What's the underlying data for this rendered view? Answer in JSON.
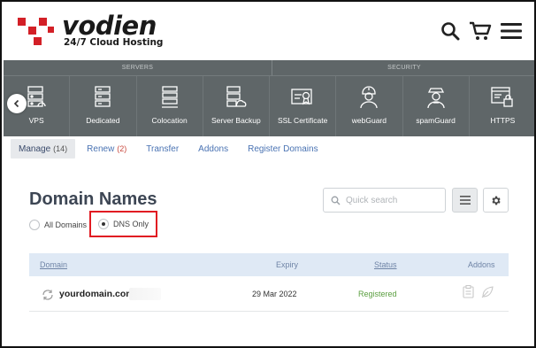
{
  "brand": {
    "name": "vodien",
    "tagline": "24/7 Cloud Hosting",
    "colors": {
      "logo_red": "#d32027",
      "logo_text": "#1a1a1a"
    }
  },
  "header": {
    "icons": [
      "search-icon",
      "cart-icon",
      "menu-icon"
    ]
  },
  "categories": {
    "servers_heading": "SERVERS",
    "security_heading": "SECURITY",
    "items": [
      {
        "label": "VPS",
        "icon": "vps-server-icon"
      },
      {
        "label": "Dedicated",
        "icon": "dedicated-server-icon"
      },
      {
        "label": "Colocation",
        "icon": "colocation-icon"
      },
      {
        "label": "Server Backup",
        "icon": "server-backup-icon"
      },
      {
        "label": "SSL Certificate",
        "icon": "ssl-certificate-icon"
      },
      {
        "label": "webGuard",
        "icon": "webguard-icon"
      },
      {
        "label": "spamGuard",
        "icon": "spamguard-icon"
      },
      {
        "label": "HTTPS",
        "icon": "https-icon"
      }
    ],
    "bar_color": "#5f6668"
  },
  "tabs": [
    {
      "label": "Manage",
      "count": "(14)",
      "active": true
    },
    {
      "label": "Renew",
      "count": "(2)",
      "active": false
    },
    {
      "label": "Transfer",
      "count": "",
      "active": false
    },
    {
      "label": "Addons",
      "count": "",
      "active": false
    },
    {
      "label": "Register Domains",
      "count": "",
      "active": false
    }
  ],
  "page": {
    "title": "Domain Names",
    "filter": {
      "options": [
        "All Domains",
        "DNS Only"
      ],
      "selected": "DNS Only"
    },
    "search": {
      "placeholder": "Quick search",
      "value": ""
    },
    "highlight_color": "#e11b22"
  },
  "table": {
    "columns": [
      "Domain",
      "Expiry",
      "Status",
      "Addons"
    ],
    "rows": [
      {
        "domain": "yourdomain.com",
        "expiry": "29 Mar 2022",
        "status": "Registered"
      }
    ],
    "status_color": "#5a9e3f",
    "header_bg": "#dfe9f5"
  }
}
